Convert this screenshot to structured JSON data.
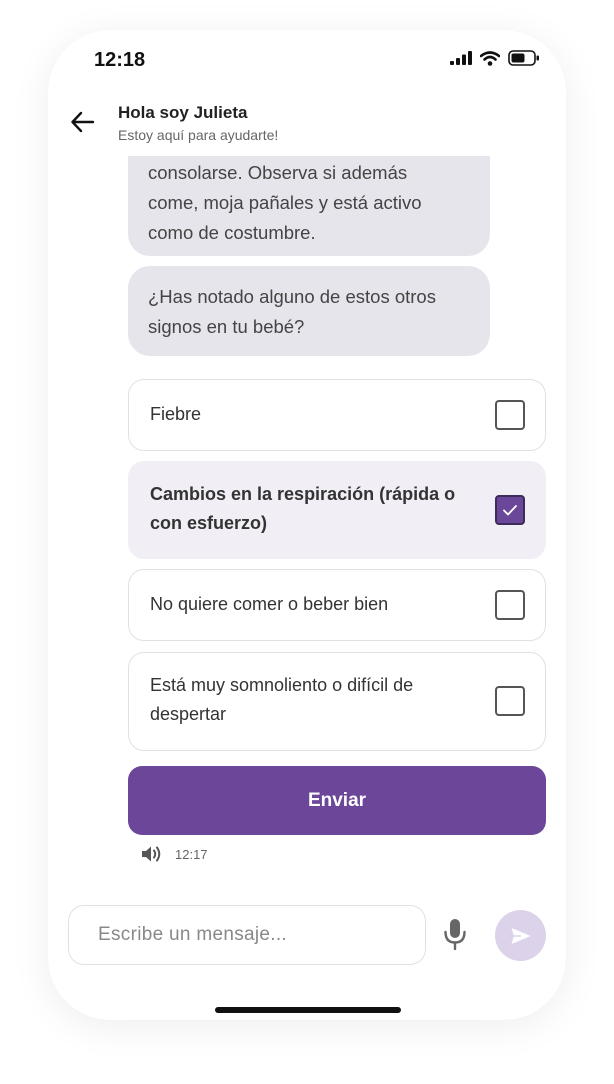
{
  "status_bar": {
    "time": "12:18"
  },
  "header": {
    "title": "Hola soy Julieta",
    "subtitle": "Estoy aquí para ayudarte!"
  },
  "messages": [
    {
      "lines": [
        "consolarse. Observa si además",
        "come, moja pañales y está activo",
        "como de costumbre."
      ]
    },
    {
      "lines": [
        "¿Has notado alguno de estos otros",
        "signos en tu bebé?"
      ]
    }
  ],
  "options": [
    {
      "lines": [
        "Fiebre"
      ],
      "checked": false
    },
    {
      "lines": [
        "Cambios en la respiración (rápida o",
        "con esfuerzo)"
      ],
      "checked": true
    },
    {
      "lines": [
        "No quiere comer o beber bien"
      ],
      "checked": false
    },
    {
      "lines": [
        "Está muy somnoliento o difícil de",
        "despertar"
      ],
      "checked": false
    }
  ],
  "submit_label": "Enviar",
  "message_time": "12:17",
  "composer": {
    "placeholder": "Escribe un mensaje..."
  },
  "colors": {
    "accent": "#6b4699",
    "bot_bubble": "#e7e5ec",
    "selected_option": "#f1eff5",
    "send_button_disabled": "#dcd3ea"
  },
  "icons": {
    "back": "arrow-left-icon",
    "signal": "cellular-signal-icon",
    "wifi": "wifi-icon",
    "battery": "battery-icon",
    "speaker": "speaker-icon",
    "mic": "microphone-icon",
    "send": "send-icon",
    "check": "check-icon"
  }
}
